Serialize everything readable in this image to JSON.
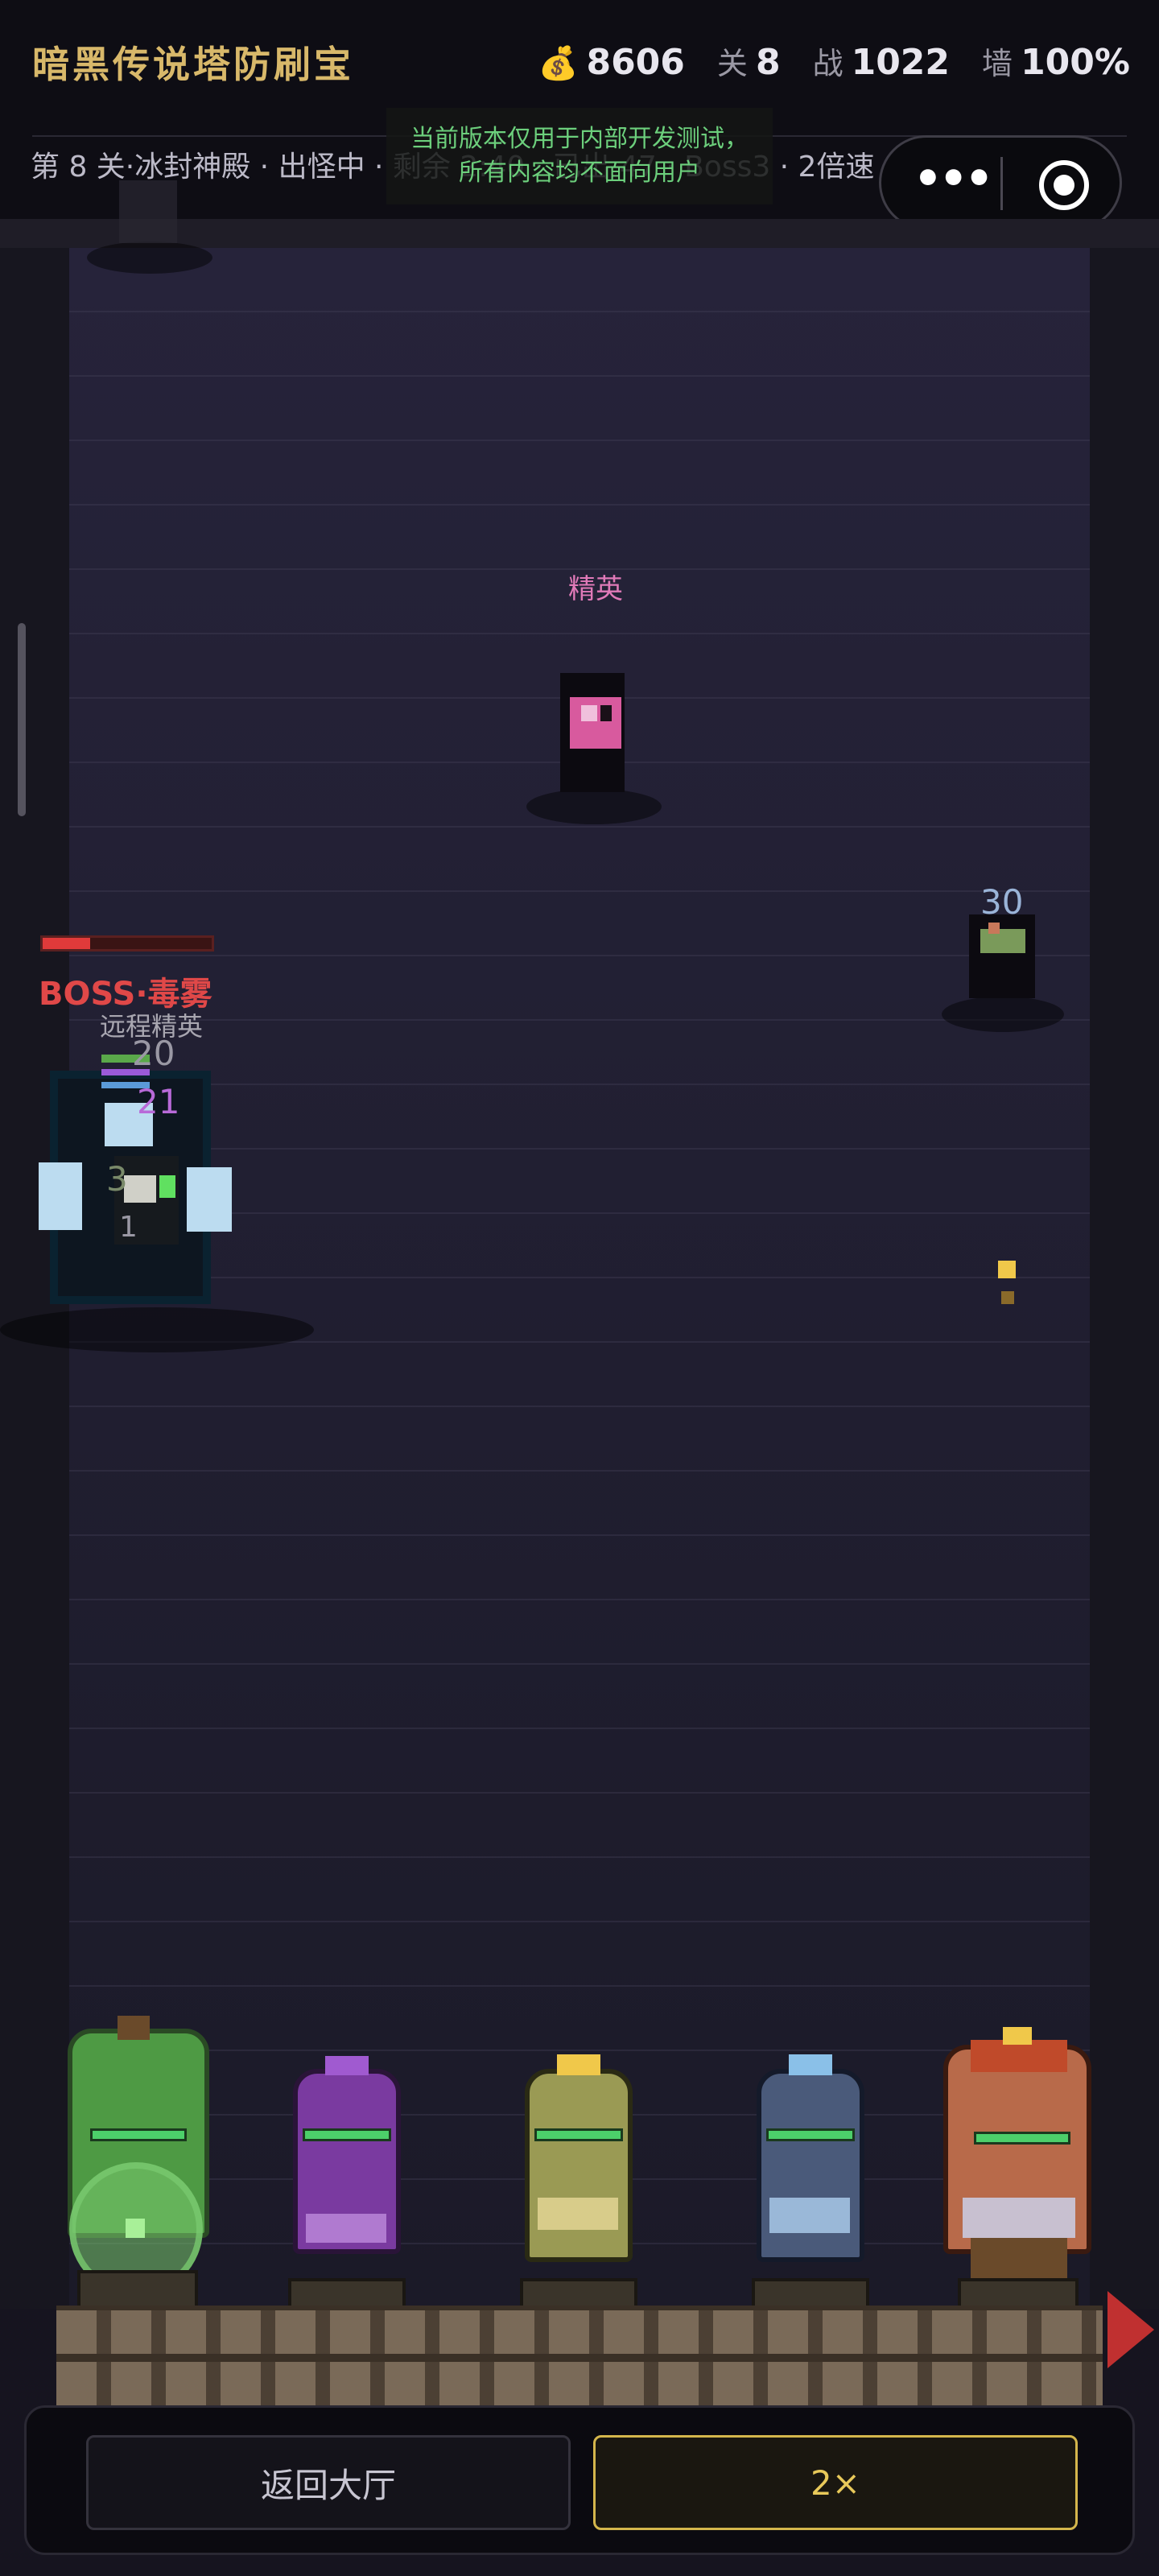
{
  "header": {
    "title": "暗黑传说塔防刷宝",
    "gold_icon": "money-bag-icon",
    "gold": "8606",
    "level_label": "关",
    "level": "8",
    "power_label": "战",
    "power": "1022",
    "wall_label": "墙",
    "wall": "100%",
    "subline": "第 8 关·冰封神殿 · 出怪中 · 剩余 2:40 · 已出 47 · Boss3 · 2倍速"
  },
  "dev_notice": {
    "line1": "当前版本仅用于内部开发测试，",
    "line2": "所有内容均不面向用户"
  },
  "field": {
    "elite_label": "精英",
    "enemy_hp_number": "30",
    "boss_hp_fraction": 0.28,
    "boss_name": "BOSS·毒雾",
    "boss_sub": "远程精英",
    "damage_numbers": [
      "20",
      "21",
      "3",
      "1"
    ]
  },
  "heroes": [
    {
      "name": "green-hero",
      "hp_fraction": 1.0,
      "color": "#5aa84a"
    },
    {
      "name": "purple-hero",
      "hp_fraction": 1.0,
      "color": "#8a4ab0"
    },
    {
      "name": "yellow-hero",
      "hp_fraction": 1.0,
      "color": "#b8b060"
    },
    {
      "name": "blue-hero",
      "hp_fraction": 1.0,
      "color": "#5a7ab0"
    },
    {
      "name": "red-hero",
      "hp_fraction": 1.0,
      "color": "#c05a3a"
    }
  ],
  "bottom": {
    "lobby_button": "返回大厅",
    "speed_button": "2×"
  },
  "colors": {
    "gold_title": "#d8b86a",
    "boss_red": "#e04848",
    "hp_green": "#4cd06a",
    "speed_accent": "#d4b64c"
  }
}
